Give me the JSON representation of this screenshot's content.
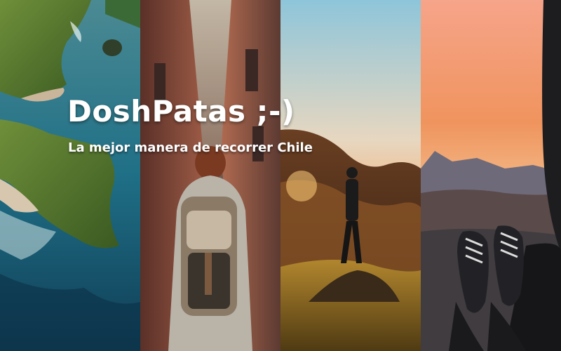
{
  "hero": {
    "title": "DoshPatas ;-)",
    "subtitle": "La mejor manera de recorrer Chile"
  },
  "photos": [
    {
      "name": "coastal-cliffs-photo"
    },
    {
      "name": "backpacker-alley-photo"
    },
    {
      "name": "mountain-hiker-sunset-photo"
    },
    {
      "name": "sneakers-sunset-view-photo"
    }
  ],
  "colors": {
    "title_text": "#ffffff",
    "ocean": "#1f6f86",
    "cliff_green": "#4f7a2e",
    "alley_wall": "#9b5a45",
    "sunset_orange": "#f0945e",
    "sky_pink": "#f6a48a"
  }
}
